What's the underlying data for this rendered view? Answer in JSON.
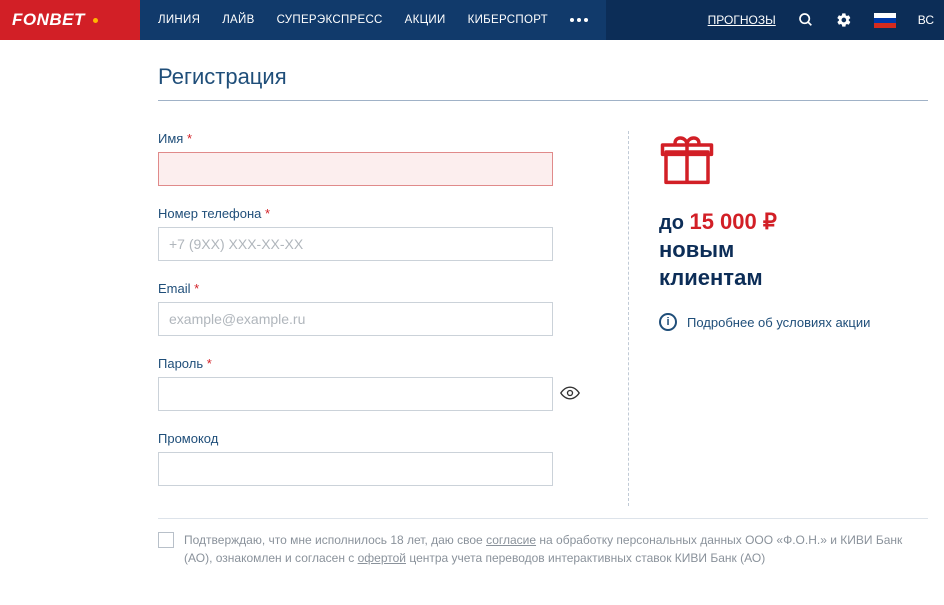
{
  "header": {
    "logo": "FONBET",
    "nav": [
      "ЛИНИЯ",
      "ЛАЙВ",
      "СУПЕРЭКСПРЕСС",
      "АКЦИИ",
      "КИБЕРСПОРТ"
    ],
    "predictions": "ПРОГНОЗЫ",
    "login_cut": "ВС"
  },
  "page_title": "Регистрация",
  "form": {
    "name": {
      "label": "Имя",
      "value": ""
    },
    "phone": {
      "label": "Номер телефона",
      "placeholder": "+7 (9XX) XXX-XX-XX",
      "value": ""
    },
    "email": {
      "label": "Email",
      "placeholder": "example@example.ru",
      "value": ""
    },
    "password": {
      "label": "Пароль",
      "value": ""
    },
    "promocode": {
      "label": "Промокод",
      "value": ""
    }
  },
  "promo": {
    "prefix": "до ",
    "amount": "15 000 ₽",
    "line2": "новым",
    "line3": "клиентам",
    "more": "Подробнее об условиях акции"
  },
  "consent": {
    "t1": "Подтверждаю, что мне исполнилось 18 лет, даю свое ",
    "a1": "согласие",
    "t2": " на обработку персональных данных ООО «Ф.О.Н.» и КИВИ Банк (АО), ознакомлен и согласен с ",
    "a2": "офертой",
    "t3": " центра учета переводов интерактивных ставок КИВИ Банк (АО)"
  },
  "required_mark": " *"
}
